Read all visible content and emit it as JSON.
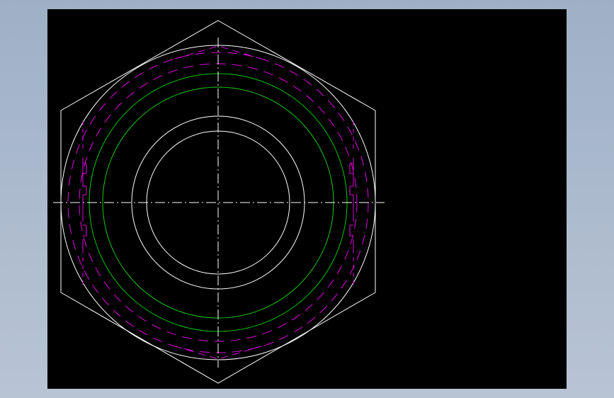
{
  "background": {
    "outer_color": "#a9b8cb",
    "viewport_color": "#000000"
  },
  "colors": {
    "outline": "#ffffff",
    "thread": "#00c800",
    "hidden": "#e000e0",
    "centerline": "#ffffff"
  },
  "drawing": {
    "type": "hex-nut-end-view",
    "features": [
      "hexagon-outline",
      "chamfer-circle",
      "bore-circles",
      "thread-circles",
      "hidden-line-circles",
      "centerlines"
    ]
  }
}
